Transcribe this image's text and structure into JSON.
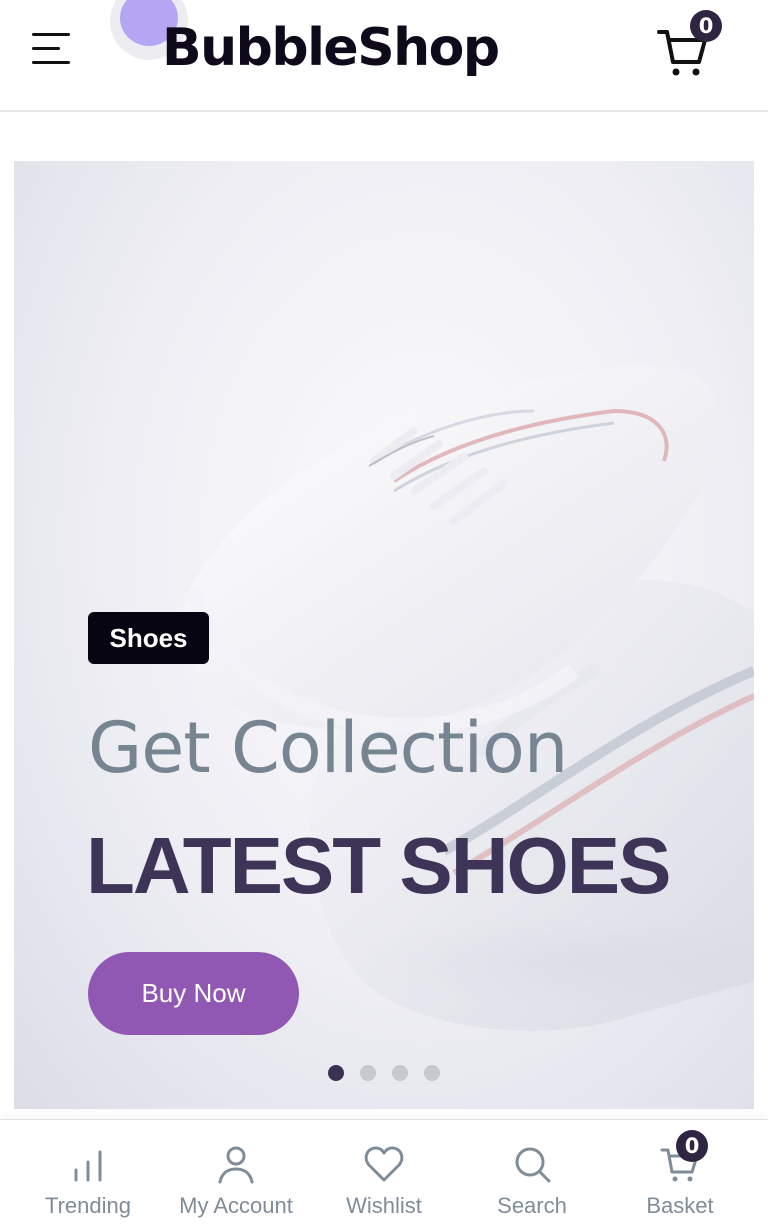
{
  "header": {
    "logo_text": "BubbleShop",
    "menu_icon": "hamburger-menu-icon",
    "cart_icon": "cart-icon",
    "cart_count": "0"
  },
  "hero": {
    "tag": "Shoes",
    "subtitle": "Get Collection",
    "title": "LATEST SHOES",
    "button_label": "Buy Now",
    "slides": 4,
    "active_slide": 1
  },
  "bottom_nav": {
    "items": [
      {
        "label": "Trending",
        "icon": "bar-chart-icon"
      },
      {
        "label": "My Account",
        "icon": "user-icon"
      },
      {
        "label": "Wishlist",
        "icon": "heart-icon"
      },
      {
        "label": "Search",
        "icon": "search-icon"
      },
      {
        "label": "Basket",
        "icon": "cart-icon",
        "badge": "0"
      }
    ]
  },
  "colors": {
    "brand_dot": "#b4a6f3",
    "button": "#9158b3",
    "title": "#3e3458",
    "subtitle": "#778592",
    "badge": "#2e2640",
    "nav_text": "#808c98"
  }
}
